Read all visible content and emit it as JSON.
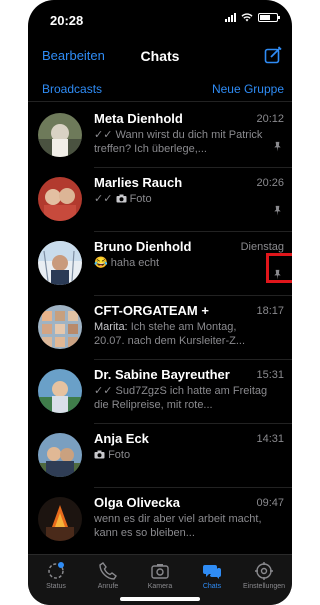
{
  "status": {
    "time": "20:28"
  },
  "nav": {
    "edit": "Bearbeiten",
    "title": "Chats"
  },
  "subnav": {
    "broadcasts": "Broadcasts",
    "new_group": "Neue Gruppe"
  },
  "chats": [
    {
      "name": "Meta Dienhold",
      "time": "20:12",
      "check": "✓✓",
      "preview": "Wann wirst du dich mit Patrick treffen? Ich überlege,...",
      "pinned": true
    },
    {
      "name": "Marlies Rauch",
      "time": "20:26",
      "check": "✓✓",
      "icon": "camera-icon",
      "preview": "Foto",
      "pinned": true
    },
    {
      "name": "Bruno Dienhold",
      "time": "Dienstag",
      "emoji": "😂",
      "preview": "haha echt",
      "pinned": true
    },
    {
      "name": "CFT-ORGATEAM +",
      "time": "18:17",
      "sender": "Marita:",
      "preview": "Ich stehe am Montag, 20.07. nach dem Kursleiter-Z..."
    },
    {
      "name": "Dr. Sabine Bayreuther",
      "time": "15:31",
      "check": "✓✓",
      "preview": "Sud7ZgzS ich hatte am Freitag die Relipreise, mit rote..."
    },
    {
      "name": "Anja Eck",
      "time": "14:31",
      "icon": "camera-icon",
      "preview": "Foto"
    },
    {
      "name": "Olga Olivecka",
      "time": "09:47",
      "preview": "wenn es dir aber viel arbeit macht, kann es so bleiben..."
    }
  ],
  "tabs": [
    {
      "label": "Status"
    },
    {
      "label": "Anrufe"
    },
    {
      "label": "Kamera"
    },
    {
      "label": "Chats"
    },
    {
      "label": "Einstellungen"
    }
  ],
  "colors": {
    "accent": "#2f8cf5",
    "highlight": "#e0161b",
    "muted": "#8a8a8e"
  }
}
